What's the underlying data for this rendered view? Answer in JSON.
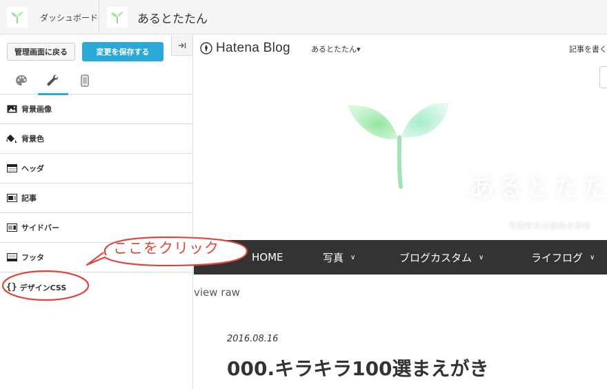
{
  "topbar": {
    "dashboard_label": "ダッシュボード",
    "blog_title": "あるとたたん"
  },
  "sidebar": {
    "back_button": "管理画面に戻る",
    "save_button": "変更を保存する",
    "collapse_label": "→|",
    "tabs": [
      {
        "name": "palette-icon",
        "active": false
      },
      {
        "name": "wrench-icon",
        "active": true
      },
      {
        "name": "smartphone-icon",
        "active": false
      }
    ],
    "items": [
      {
        "label": "背景画像",
        "icon": "image-icon"
      },
      {
        "label": "背景色",
        "icon": "paint-bucket-icon"
      },
      {
        "label": "ヘッダ",
        "icon": "header-layout-icon"
      },
      {
        "label": "記事",
        "icon": "article-layout-icon"
      },
      {
        "label": "サイドバー",
        "icon": "sidebar-layout-icon"
      },
      {
        "label": "フッタ",
        "icon": "footer-layout-icon"
      },
      {
        "label": "デザインCSS",
        "icon": "braces-icon",
        "icon_text": "{}"
      }
    ]
  },
  "annotation": {
    "text": "ここをクリック",
    "color": "#e0453a"
  },
  "preview": {
    "hatena_brand": "Hatena Blog",
    "user_menu": "あるとたたん",
    "user_menu_caret": "▾",
    "write_link": "記事を書く",
    "header_title": "あるとたたん",
    "header_subtitle": "写真好きの前向き日誌",
    "nav": [
      {
        "label": "HOME",
        "dropdown": false
      },
      {
        "label": "写真",
        "dropdown": true
      },
      {
        "label": "ブログカスタム",
        "dropdown": true
      },
      {
        "label": "ライフログ",
        "dropdown": true
      }
    ],
    "nav_chevron": "∨",
    "view_raw": "view raw",
    "post_date": "2016.08.16",
    "post_title": "000.キラキラ100選まえがき"
  },
  "colors": {
    "accent": "#2ba9d6",
    "nav_bg": "#333333",
    "annotation_red": "#e0453a"
  }
}
